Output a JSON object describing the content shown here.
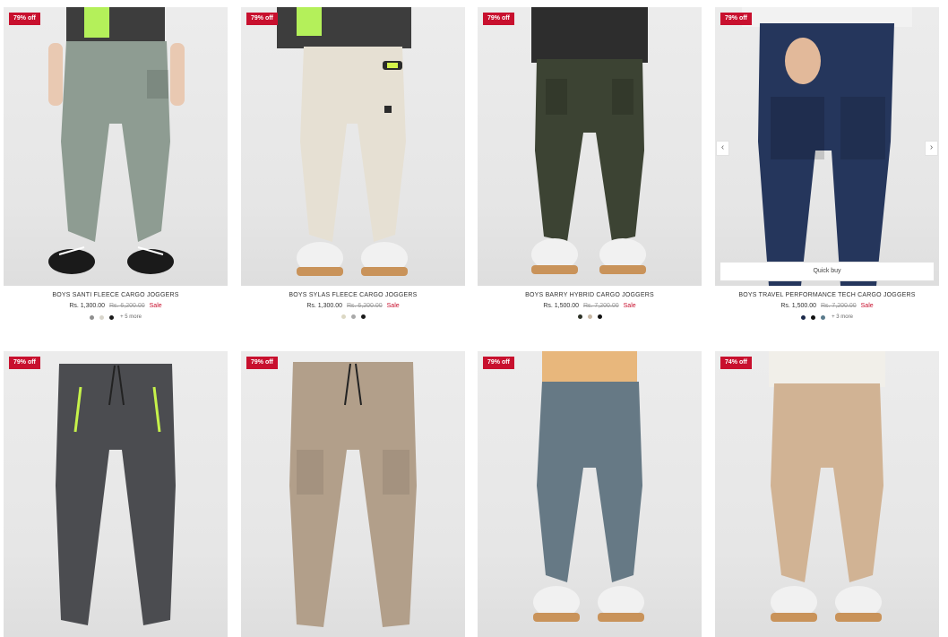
{
  "products": [
    {
      "badge": "79% off",
      "title": "BOYS SANTI FLEECE CARGO JOGGERS",
      "price": "Rs. 1,300.00",
      "old_price": "Rs. 6,200.00",
      "sale": "Sale",
      "swatches": [
        "#8f8f8f",
        "#d9d6cc",
        "#1a1a1a"
      ],
      "more": "+ 5 more",
      "pant_color": "#8e9c92"
    },
    {
      "badge": "79% off",
      "title": "BOYS SYLAS FLEECE CARGO JOGGERS",
      "price": "Rs. 1,300.00",
      "old_price": "Rs. 6,200.00",
      "sale": "Sale",
      "swatches": [
        "#dcd8c4",
        "#a9a9a9",
        "#1a1a1a"
      ],
      "pant_color": "#e6e0d3"
    },
    {
      "badge": "79% off",
      "title": "BOYS BARRY HYBRID CARGO JOGGERS",
      "price": "Rs. 1,500.00",
      "old_price": "Rs. 7,200.00",
      "sale": "Sale",
      "swatches": [
        "#2e3328",
        "#c9b9a6",
        "#111111"
      ],
      "pant_color": "#3c4333"
    },
    {
      "badge": "79% off",
      "title": "BOYS TRAVEL PERFORMANCE TECH CARGO JOGGERS",
      "price": "Rs. 1,500.00",
      "old_price": "Rs. 7,200.00",
      "sale": "Sale",
      "swatches": [
        "#1c2a4a",
        "#111111",
        "#5a7b8c"
      ],
      "more": "+ 3 more",
      "pant_color": "#25365c",
      "quick_buy": "Quick buy",
      "prev_icon": "‹",
      "next_icon": "›"
    },
    {
      "badge": "79% off",
      "pant_color": "#4b4c50"
    },
    {
      "badge": "79% off",
      "pant_color": "#b29f8a"
    },
    {
      "badge": "79% off",
      "pant_color": "#667985"
    },
    {
      "badge": "74% off",
      "pant_color": "#d1b394"
    }
  ]
}
